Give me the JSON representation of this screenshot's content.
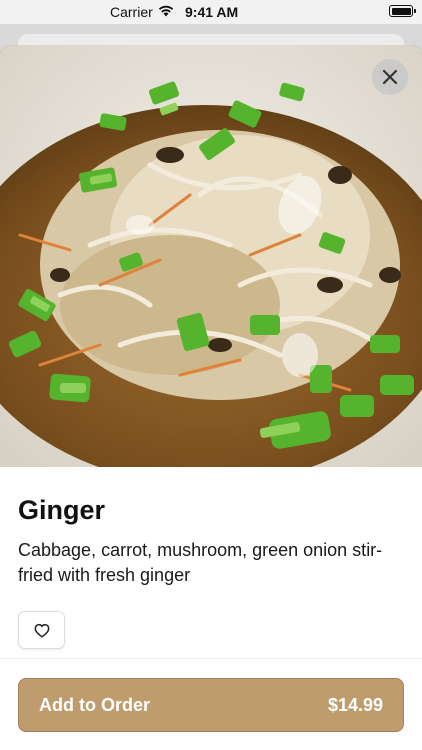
{
  "status_bar": {
    "carrier": "Carrier",
    "time": "9:41 AM"
  },
  "item": {
    "name": "Ginger",
    "description": "Cabbage, carrot, mushroom, green onion stir-fried with fresh ginger",
    "image_icon": "dish-photo"
  },
  "actions": {
    "close_icon": "close-icon",
    "favorite_icon": "heart-icon",
    "add_label": "Add to Order",
    "price": "$14.99"
  },
  "colors": {
    "accent": "#bf9c6e",
    "accent_border": "#a3825a",
    "text": "#111111"
  }
}
